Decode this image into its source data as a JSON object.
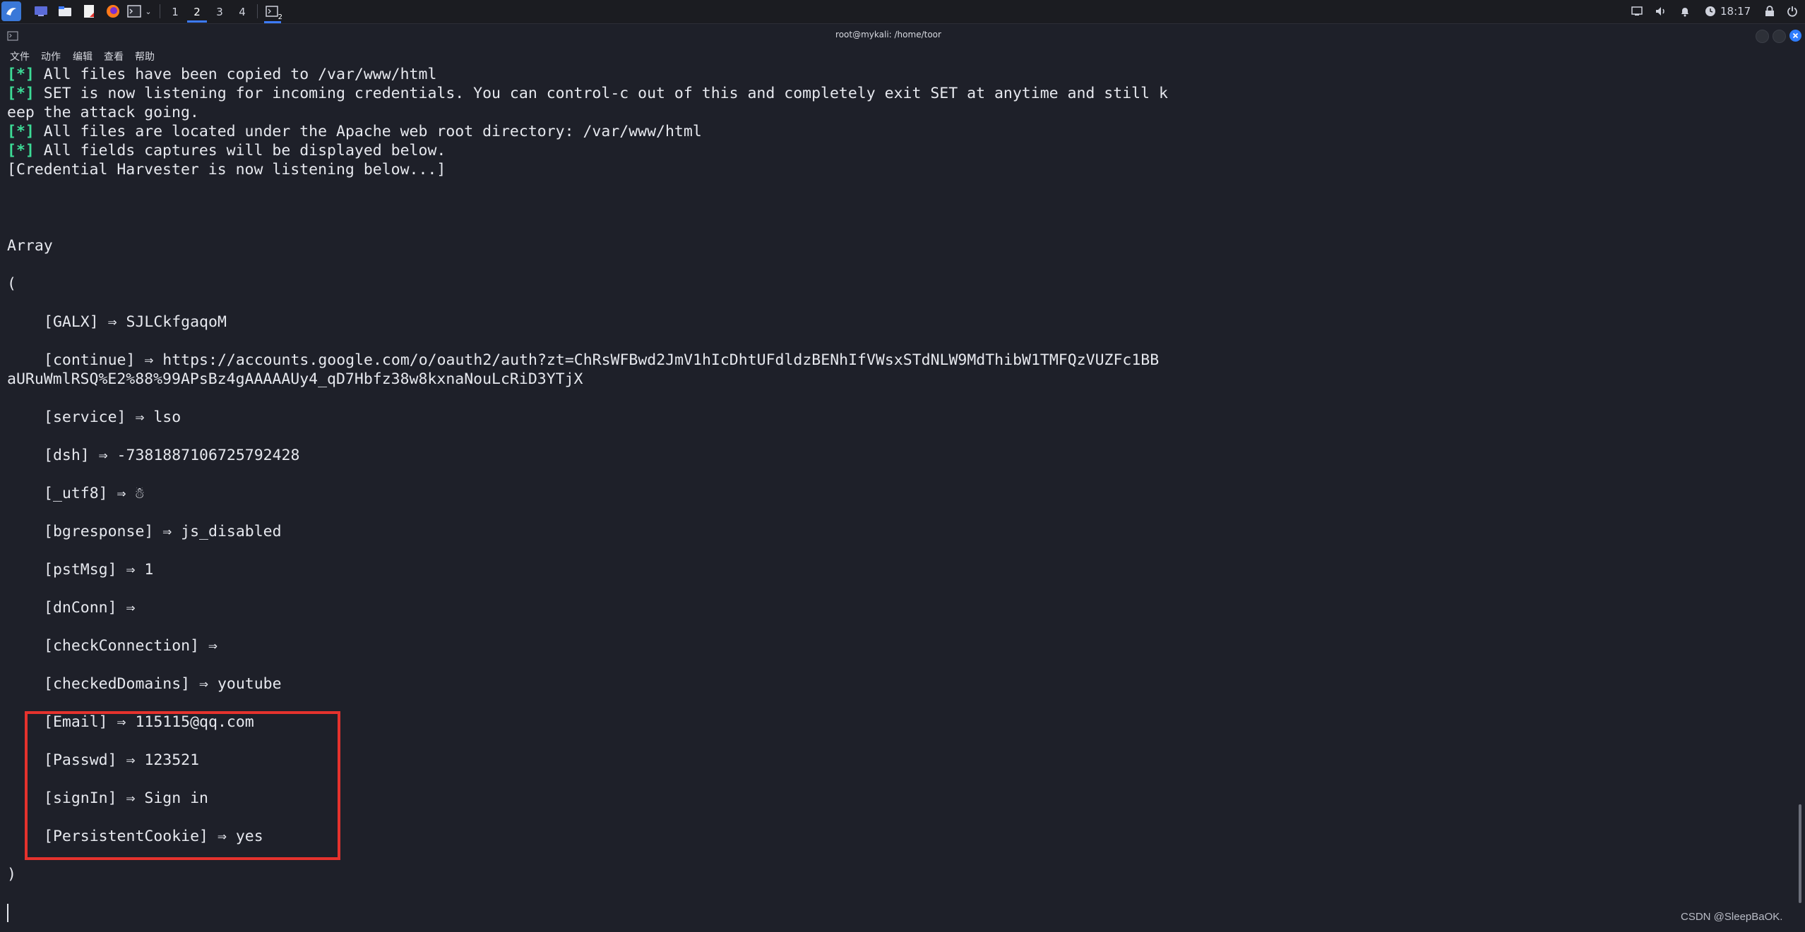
{
  "taskbar": {
    "workspaces": [
      "1",
      "2",
      "3",
      "4"
    ],
    "active_workspace": "2",
    "terminal_badge": "2",
    "clock": "18:17",
    "icons": [
      "kali-menu-icon",
      "desktop-icon",
      "files-icon",
      "text-editor-icon",
      "firefox-icon",
      "terminal-icon",
      "dropdown-chevron-icon",
      "window-icon",
      "display-icon",
      "volume-icon",
      "bell-icon",
      "clock-icon",
      "lock-icon",
      "power-icon"
    ]
  },
  "window": {
    "title": "root@mykali: /home/toor"
  },
  "menu": {
    "items": [
      "文件",
      "动作",
      "编辑",
      "查看",
      "帮助"
    ]
  },
  "terminal": {
    "status_lines": [
      {
        "marker": "[*]",
        "text": " All files have been copied to /var/www/html"
      },
      {
        "marker": "[*]",
        "text": " SET is now listening for incoming credentials. You can control-c out of this and completely exit SET at anytime and still k"
      },
      {
        "marker": "",
        "text": "eep the attack going."
      },
      {
        "marker": "[*]",
        "text": " All files are located under the Apache web root directory: /var/www/html"
      },
      {
        "marker": "[*]",
        "text": " All fields captures will be displayed below."
      },
      {
        "marker": "",
        "text": "[Credential Harvester is now listening below...]"
      }
    ],
    "array_label": "Array",
    "open_paren": "(",
    "close_paren": ")",
    "fields": {
      "galx": "[GALX] ⇒ SJLCkfgaqoM",
      "continue_1": "[continue] ⇒ https://accounts.google.com/o/oauth2/auth?zt=ChRsWFBwd2JmV1hIcDhtUFdldzBENhIfVWsxSTdNLW9MdThibW1TMFQzVUZFc1BB",
      "continue_2": "aURuWmlRSQ%E2%88%99APsBz4gAAAAAUy4_qD7Hbfz38w8kxnaNouLcRiD3YTjX",
      "service": "[service] ⇒ lso",
      "dsh": "[dsh] ⇒ -7381887106725792428",
      "utf8": "[_utf8] ⇒ ☃",
      "bgresponse": "[bgresponse] ⇒ js_disabled",
      "pstmsg": "[pstMsg] ⇒ 1",
      "dnconn": "[dnConn] ⇒",
      "checkconnection": "[checkConnection] ⇒",
      "checkeddomains": "[checkedDomains] ⇒ youtube",
      "email": "[Email] ⇒ 115115@qq.com",
      "passwd": "[Passwd] ⇒ 123521",
      "signin": "[signIn] ⇒ Sign in",
      "persistentcookie": "[PersistentCookie] ⇒ yes"
    }
  },
  "watermark": "CSDN @SleepBaOK.",
  "colors": {
    "background": "#1e2029",
    "marker_green": "#3ddc97",
    "highlight_red": "#e5322d",
    "close_button_blue": "#2f7dff"
  }
}
